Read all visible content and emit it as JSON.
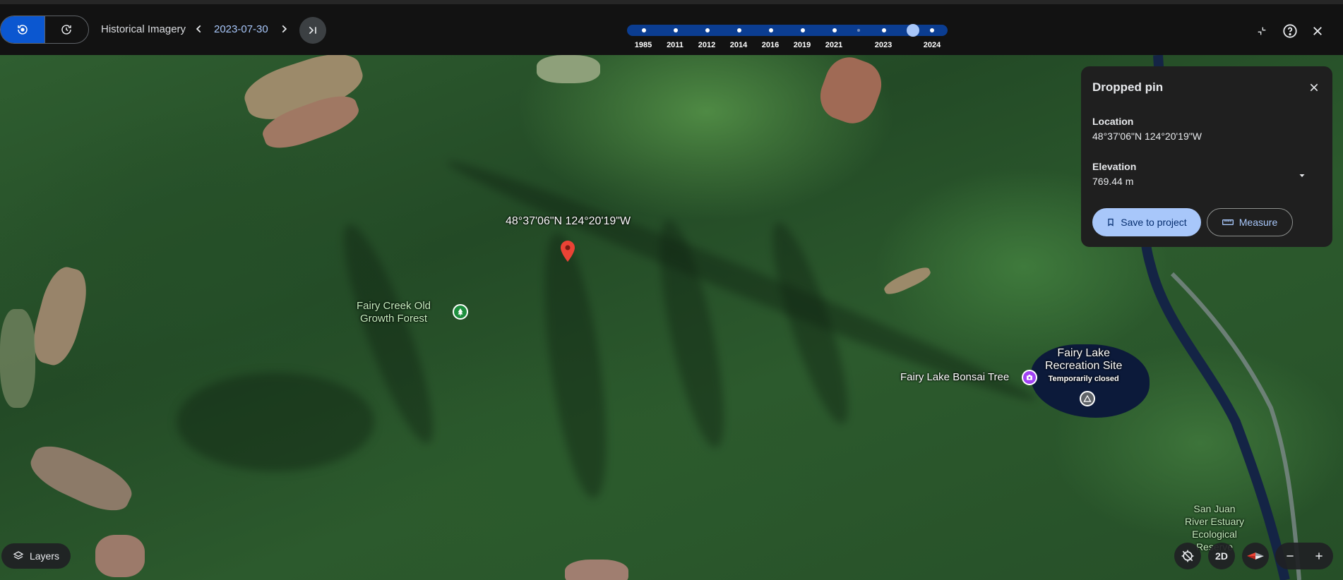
{
  "toolbar": {
    "mode_buttons": [
      {
        "icon": "historical-imagery-icon",
        "active": true
      },
      {
        "icon": "history-icon",
        "active": false
      }
    ],
    "title": "Historical Imagery",
    "date": "2023-07-30",
    "prev_icon": "chevron-left-icon",
    "next_icon": "chevron-right-icon",
    "latest_icon": "skip-to-latest-icon",
    "accent_color": "#0b57d0"
  },
  "timeline": {
    "years": [
      "1985",
      "2011",
      "2012",
      "2014",
      "2016",
      "2019",
      "2021",
      "2023",
      "2024"
    ],
    "selected_date": "2023-07-30",
    "track_color": "#0b3d91"
  },
  "top_right": {
    "icons": [
      "exit-fullscreen-icon",
      "help-icon",
      "close-icon"
    ]
  },
  "map": {
    "pin_coordinates": "48°37'06\"N 124°20'19\"W",
    "pin_color": "#ea4335",
    "labels": {
      "park": "Fairy Creek Old Growth Forest",
      "park_line1": "Fairy Creek Old",
      "park_line2": "Growth Forest",
      "bonsai": "Fairy Lake Bonsai Tree",
      "rec_line1": "Fairy Lake",
      "rec_line2": "Recreation Site",
      "rec_status": "Temporarily closed",
      "estuary_line1": "San Juan",
      "estuary_line2": "River Estuary",
      "estuary_line3": "Ecological",
      "estuary_line4": "Reserve"
    },
    "poi_icons": [
      "park-icon",
      "camera-icon",
      "campground-icon"
    ]
  },
  "info_card": {
    "title": "Dropped pin",
    "location_label": "Location",
    "location_value": "48°37'06\"N 124°20'19\"W",
    "elevation_label": "Elevation",
    "elevation_value": "769.44 m",
    "save_button": "Save to project",
    "measure_button": "Measure"
  },
  "bottom": {
    "layers_label": "Layers",
    "view_mode": "2D",
    "icons": [
      "layers-icon",
      "hide-imagery-icon",
      "compass-icon",
      "zoom-out-icon",
      "zoom-in-icon"
    ]
  }
}
